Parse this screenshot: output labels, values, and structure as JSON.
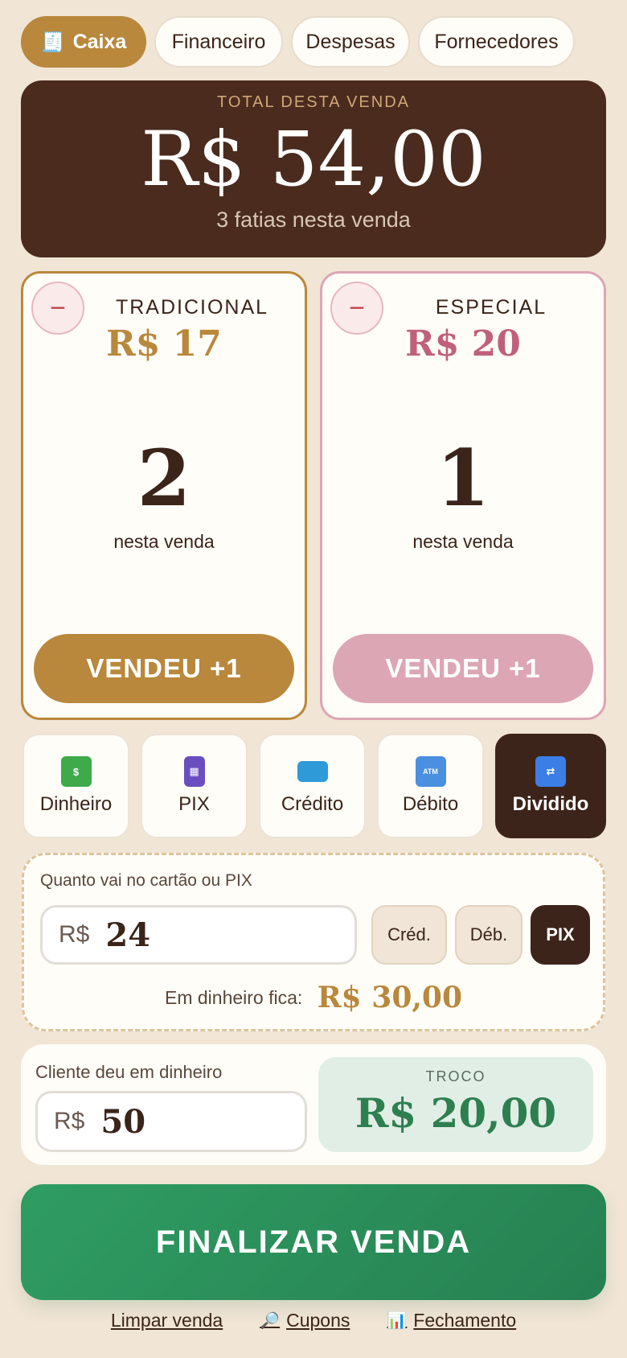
{
  "tabs": [
    {
      "icon": "🧾",
      "label": "Caixa",
      "active": true
    },
    {
      "label": "Financeiro"
    },
    {
      "label": "Despesas"
    },
    {
      "label": "Fornecedores"
    }
  ],
  "total": {
    "label": "TOTAL DESTA VENDA",
    "value": "R$ 54,00",
    "subtitle": "3 fatias nesta venda"
  },
  "products": [
    {
      "name": "TRADICIONAL",
      "price": "R$ 17",
      "count": "2",
      "count_label": "nesta venda",
      "minus": "−",
      "button": "VENDEU +1"
    },
    {
      "name": "ESPECIAL",
      "price": "R$ 20",
      "count": "1",
      "count_label": "nesta venda",
      "minus": "−",
      "button": "VENDEU +1"
    }
  ],
  "payment_methods": [
    {
      "label": "Dinheiro",
      "icon": "money-icon"
    },
    {
      "label": "PIX",
      "icon": "phone-icon"
    },
    {
      "label": "Crédito",
      "icon": "credit-card-icon"
    },
    {
      "label": "Débito",
      "icon": "atm-icon",
      "icon_text": "ATM"
    },
    {
      "label": "Dividido",
      "icon": "shuffle-icon",
      "active": true
    }
  ],
  "split": {
    "label": "Quanto vai no cartão ou PIX",
    "currency": "R$",
    "amount": "24",
    "types": [
      "Créd.",
      "Déb.",
      "PIX"
    ],
    "selected_type": "PIX",
    "cash_label": "Em dinheiro fica:",
    "cash_value": "R$ 30,00"
  },
  "change": {
    "label": "Cliente deu em dinheiro",
    "currency": "R$",
    "amount": "50",
    "troco_label": "TROCO",
    "troco_value": "R$ 20,00"
  },
  "finalize_label": "FINALIZAR VENDA",
  "footer": [
    {
      "label": "Limpar venda"
    },
    {
      "icon": "🔎",
      "label": "Cupons"
    },
    {
      "icon": "📊",
      "label": "Fechamento"
    }
  ],
  "colors": {
    "background": "#f1e5d6",
    "accent_gold": "#b9883c",
    "accent_pink": "#dca6b4",
    "dark_brown": "#3d241a",
    "success_green": "#2e8a58"
  }
}
